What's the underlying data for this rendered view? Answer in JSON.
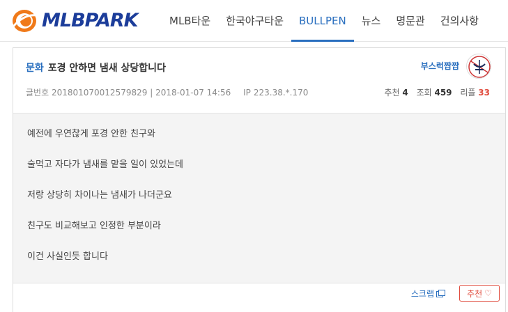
{
  "header": {
    "logo_text": "MLBPARK",
    "nav": [
      "MLB타운",
      "한국야구타운",
      "BULLPEN",
      "뉴스",
      "명문관",
      "건의사항"
    ],
    "active_nav": "BULLPEN"
  },
  "post": {
    "category": "문화",
    "title": "포경 안하면 냄새 상당합니다",
    "number_label": "글번호",
    "number": "201801070012579829",
    "separator": "|",
    "datetime": "2018-01-07 14:56",
    "ip_label": "IP",
    "ip": "223.38.*.170",
    "writer": "부스럭짭짭",
    "stats": {
      "recommend_label": "추천",
      "recommend": "4",
      "views_label": "조회",
      "views": "459",
      "replies_label": "리플",
      "replies": "33"
    },
    "lines": [
      "예전에 우연찮게 포경 안한 친구와",
      "술먹고 자다가 냄새를 맡을 일이 있었는데",
      "저랑 상당히 차이나는 냄새가 나더군요",
      "친구도 비교해보고 인정한 부분이라",
      "이건 사실인듯 합니다"
    ]
  },
  "footer": {
    "scrap_label": "스크랩",
    "recommend_label": "추천",
    "heart_icon": "♡"
  },
  "colors": {
    "accent": "#2a6fbf",
    "brand": "#1c3d9a",
    "logo_orange": "#f07a1a",
    "reply_red": "#e04b3d"
  }
}
